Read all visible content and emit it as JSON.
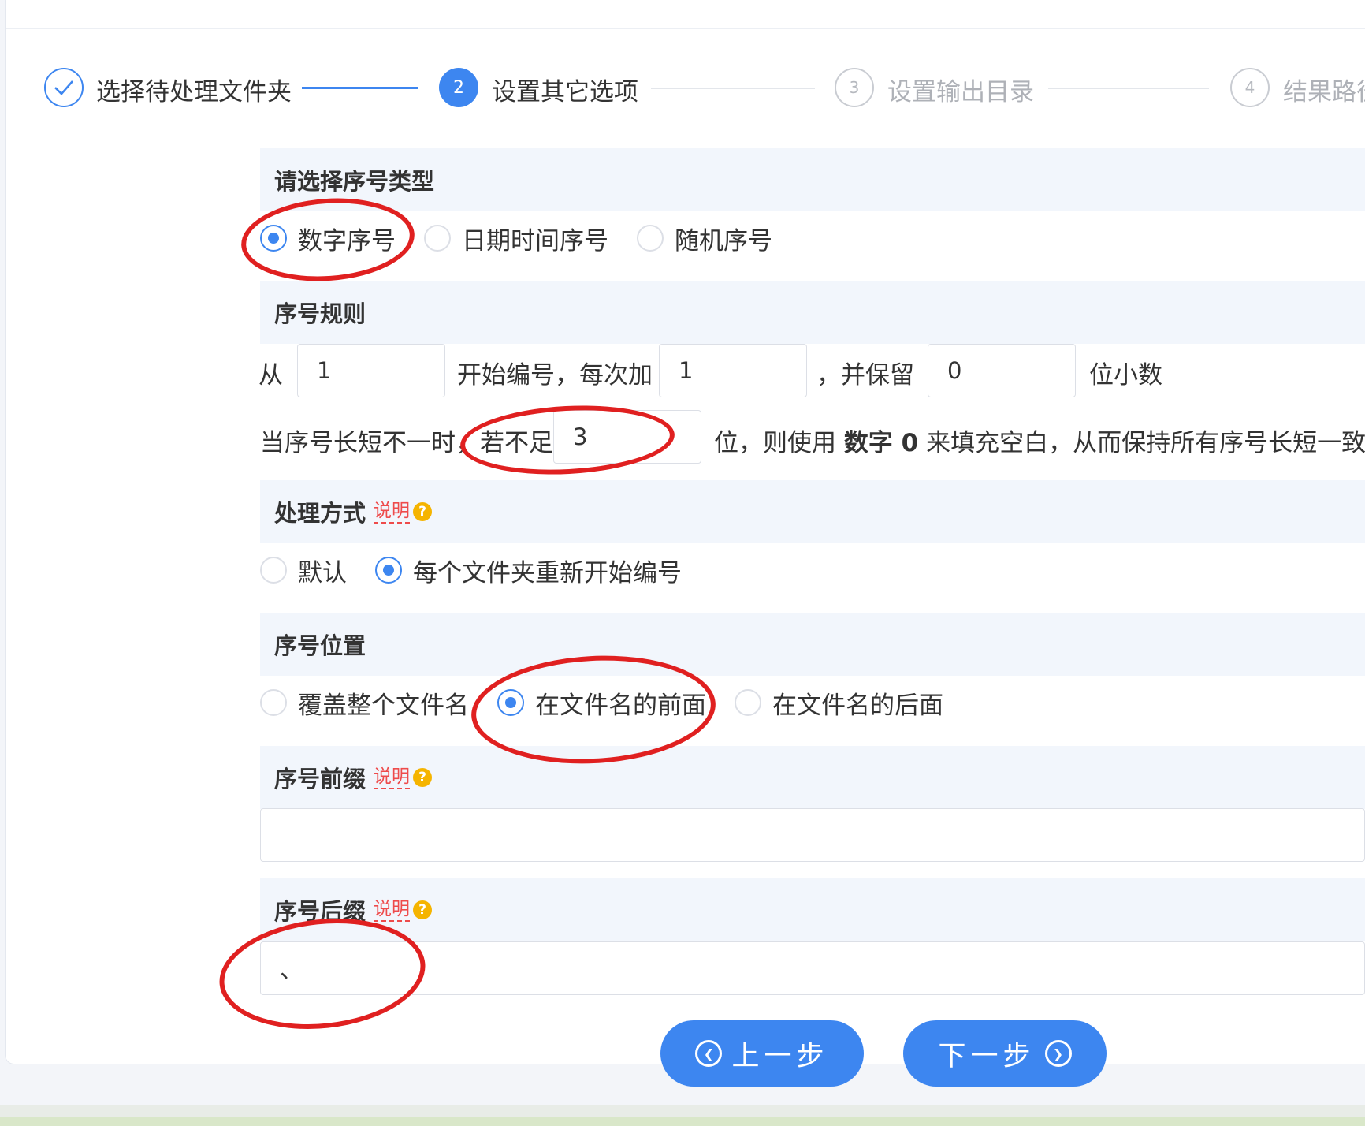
{
  "steps": [
    {
      "label": "选择待处理文件夹",
      "number": "✓",
      "state": "done"
    },
    {
      "label": "设置其它选项",
      "number": "2",
      "state": "active"
    },
    {
      "label": "设置输出目录",
      "number": "3",
      "state": "todo"
    },
    {
      "label": "结果路径",
      "number": "4",
      "state": "todo"
    }
  ],
  "serial_type": {
    "title": "请选择序号类型",
    "options": [
      "数字序号",
      "日期时间序号",
      "随机序号"
    ],
    "selected": "数字序号"
  },
  "serial_rule": {
    "title": "序号规则",
    "from_label": "从",
    "start_value": "1",
    "start_label": "开始编号，每次加",
    "step_value": "1",
    "keep_label": "，并保留",
    "decimals_value": "0",
    "decimals_label": "位小数",
    "pad_prefix": "当序号长短不一时，若不足",
    "pad_value": "3",
    "pad_middle": "位，则使用",
    "pad_bold": "数字 0",
    "pad_suffix": "来填充空白，从而保持所有序号长短一致。"
  },
  "process_mode": {
    "title": "处理方式",
    "help": "说明",
    "options": [
      "默认",
      "每个文件夹重新开始编号"
    ],
    "selected": "每个文件夹重新开始编号"
  },
  "serial_position": {
    "title": "序号位置",
    "options": [
      "覆盖整个文件名",
      "在文件名的前面",
      "在文件名的后面"
    ],
    "selected": "在文件名的前面"
  },
  "serial_prefix": {
    "title": "序号前缀",
    "help": "说明",
    "value": ""
  },
  "serial_suffix": {
    "title": "序号后缀",
    "help": "说明",
    "value": "、"
  },
  "buttons": {
    "prev": "上一步",
    "next": "下一步"
  },
  "colors": {
    "accent": "#3d86f0",
    "annotation": "#e02020",
    "help": "#ee4b4b"
  }
}
